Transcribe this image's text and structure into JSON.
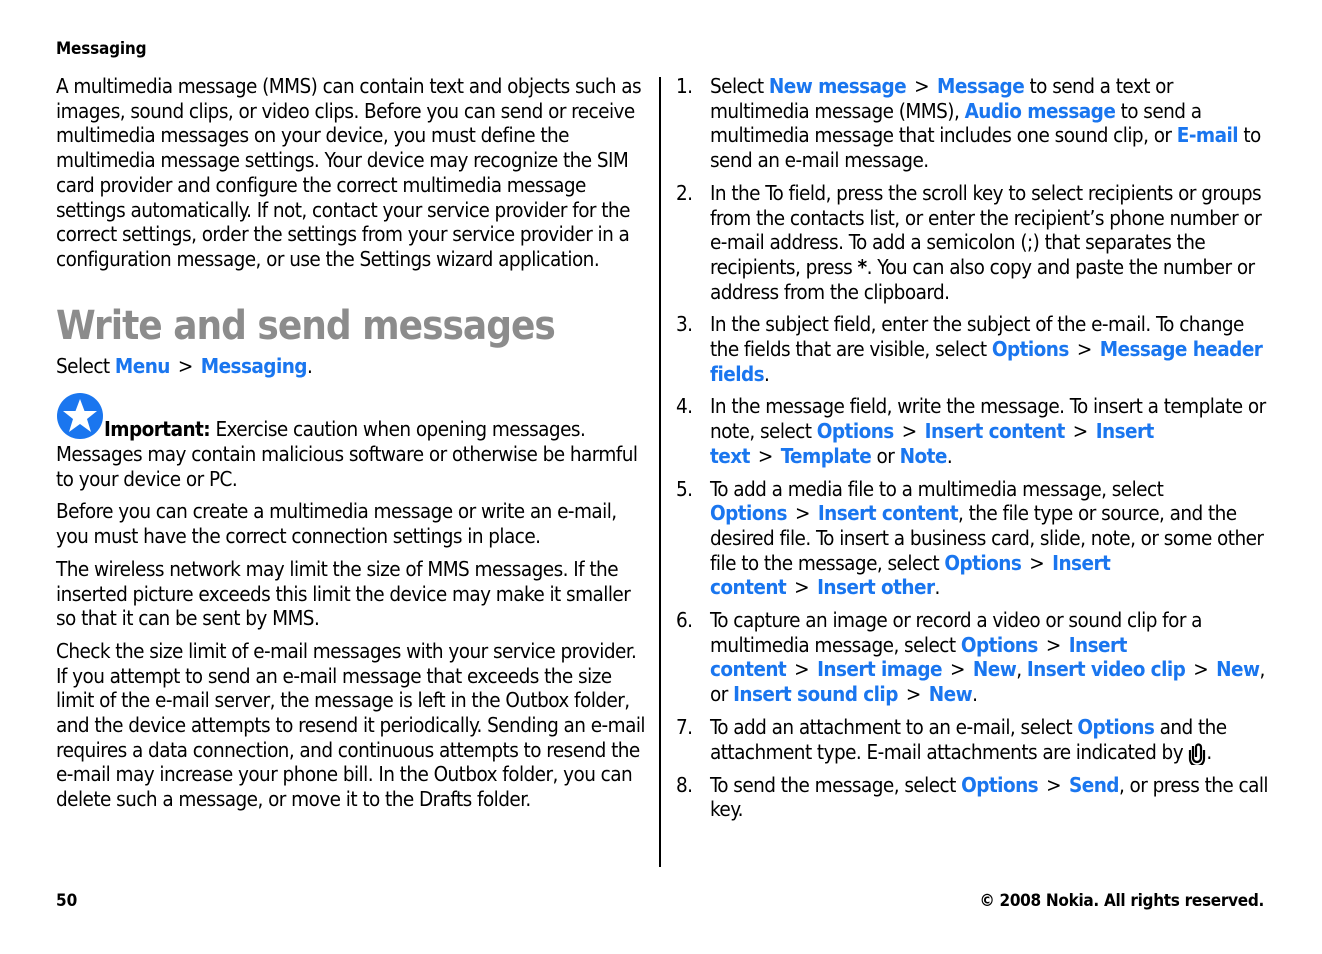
{
  "running_head": "Messaging",
  "intro_paragraph": "A multimedia message (MMS) can contain text and objects such as images, sound clips, or video clips. Before you can send or receive multimedia messages on your device, you must define the multimedia message settings. Your device may recognize the SIM card provider and configure the correct multimedia message settings automatically. If not, contact your service provider for the correct settings, order the settings from your service provider in a configuration message, or use the Settings wizard application.",
  "section_title": "Write and send messages",
  "select_path": {
    "prefix": "Select ",
    "items": [
      "Menu",
      "Messaging"
    ],
    "separator": ">",
    "suffix": "."
  },
  "important": {
    "icon": "star-icon",
    "label": "Important:",
    "text": " Exercise caution when opening messages. Messages may contain malicious software or otherwise be harmful to your device or PC."
  },
  "paragraphs": [
    "Before you can create a multimedia message or write an e-mail, you must have the correct connection settings in place.",
    "The wireless network may limit the size of MMS messages. If the inserted picture exceeds this limit the device may make it smaller so that it can be sent by MMS.",
    "Check the size limit of e-mail messages with your service provider. If you attempt to send an e-mail message that exceeds the size limit of the e-mail server, the message is left in the Outbox folder, and the device attempts to resend it periodically. Sending an e-mail requires a data connection, and continuous attempts to resend the e-mail may increase your phone bill. In the Outbox folder, you can delete such a message, or move it to the Drafts folder."
  ],
  "steps": [
    {
      "number": "1.",
      "parts": [
        {
          "t": "Select "
        },
        {
          "l": "New message"
        },
        {
          "s": ">"
        },
        {
          "l": "Message"
        },
        {
          "t": " to send a text or multimedia message (MMS), "
        },
        {
          "l": "Audio message"
        },
        {
          "t": " to send a multimedia message that includes one sound clip, or "
        },
        {
          "l": "E-mail"
        },
        {
          "t": " to send an e-mail message."
        }
      ]
    },
    {
      "number": "2.",
      "parts": [
        {
          "t": "In the To field, press the scroll key to select recipients or groups from the contacts list, or enter the recipient’s phone number or e-mail address. To add a semicolon (;) that separates the recipients, press "
        },
        {
          "b": "*"
        },
        {
          "t": ". You can also copy and paste the number or address from the clipboard."
        }
      ]
    },
    {
      "number": "3.",
      "parts": [
        {
          "t": "In the subject field, enter the subject of the e-mail. To change the fields that are visible, select "
        },
        {
          "l": "Options"
        },
        {
          "s": ">"
        },
        {
          "l": "Message header fields"
        },
        {
          "t": "."
        }
      ]
    },
    {
      "number": "4.",
      "parts": [
        {
          "t": "In the message field, write the message. To insert a template or note, select "
        },
        {
          "l": "Options"
        },
        {
          "s": ">"
        },
        {
          "l": "Insert content"
        },
        {
          "s": ">"
        },
        {
          "l": "Insert text"
        },
        {
          "s": ">"
        },
        {
          "l": "Template"
        },
        {
          "t": " or "
        },
        {
          "l": "Note"
        },
        {
          "t": "."
        }
      ]
    },
    {
      "number": "5.",
      "parts": [
        {
          "t": "To add a media file to a multimedia message, select "
        },
        {
          "l": "Options"
        },
        {
          "s": ">"
        },
        {
          "l": "Insert content"
        },
        {
          "t": ", the file type or source, and the desired file. To insert a business card, slide, note, or some other file to the message, select "
        },
        {
          "l": "Options"
        },
        {
          "s": ">"
        },
        {
          "l": "Insert content"
        },
        {
          "s": ">"
        },
        {
          "l": "Insert other"
        },
        {
          "t": "."
        }
      ]
    },
    {
      "number": "6.",
      "parts": [
        {
          "t": "To capture an image or record a video or sound clip for a multimedia message, select "
        },
        {
          "l": "Options"
        },
        {
          "s": ">"
        },
        {
          "l": "Insert content"
        },
        {
          "s": ">"
        },
        {
          "l": "Insert image"
        },
        {
          "s": ">"
        },
        {
          "l": "New"
        },
        {
          "t": ", "
        },
        {
          "l": "Insert video clip"
        },
        {
          "s": ">"
        },
        {
          "l": "New"
        },
        {
          "t": ", or "
        },
        {
          "l": "Insert sound clip"
        },
        {
          "s": ">"
        },
        {
          "l": "New"
        },
        {
          "t": "."
        }
      ]
    },
    {
      "number": "7.",
      "parts": [
        {
          "t": "To add an attachment to an e-mail, select "
        },
        {
          "l": "Options"
        },
        {
          "t": " and the attachment type. E-mail attachments are indicated by "
        },
        {
          "icon": "paperclip-icon"
        },
        {
          "t": "."
        }
      ]
    },
    {
      "number": "8.",
      "parts": [
        {
          "t": "To send the message, select "
        },
        {
          "l": "Options"
        },
        {
          "s": ">"
        },
        {
          "l": "Send"
        },
        {
          "t": ", or press the call key."
        }
      ]
    }
  ],
  "footer": {
    "page_number": "50",
    "copyright": "© 2008 Nokia. All rights reserved."
  },
  "colors": {
    "link": "#1a76ef",
    "heading": "#8c8c8c",
    "text": "#000000",
    "icon_blue": "#1a76ef"
  }
}
